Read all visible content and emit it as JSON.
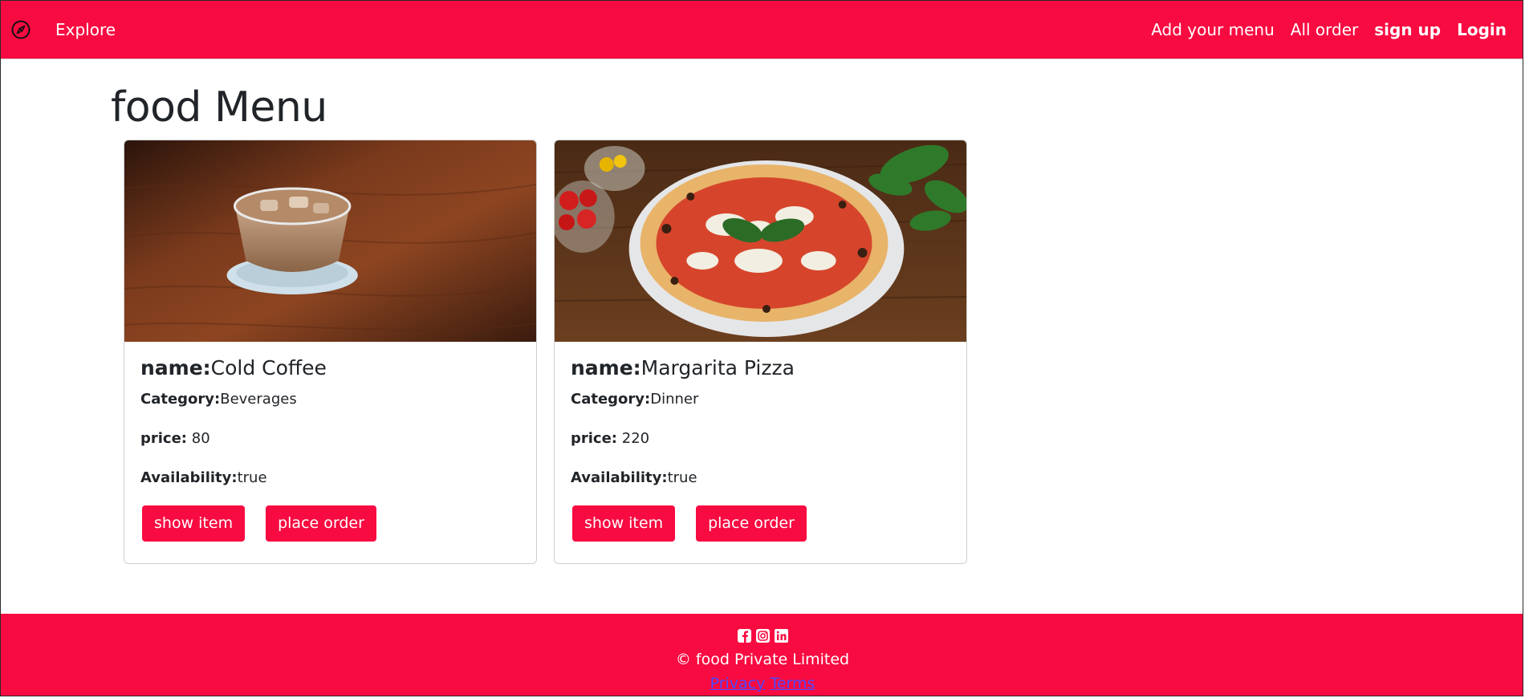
{
  "navbar": {
    "brand_icon": "compass-icon",
    "explore_label": "Explore",
    "links": {
      "add_menu": "Add your menu",
      "all_order": "All order",
      "sign_up": "sign up",
      "login": "Login"
    }
  },
  "page": {
    "title": "food Menu"
  },
  "cards": [
    {
      "image": "iced-coffee-photo",
      "name_label": "name:",
      "name": "Cold Coffee",
      "category_label": "Category:",
      "category": "Beverages",
      "price_label": "price:",
      "price": "80",
      "availability_label": "Availability:",
      "availability": "true",
      "show_label": "show item",
      "order_label": "place order"
    },
    {
      "image": "margherita-pizza-photo",
      "name_label": "name:",
      "name": "Margarita Pizza",
      "category_label": "Category:",
      "category": "Dinner",
      "price_label": "price:",
      "price": "220",
      "availability_label": "Availability:",
      "availability": "true",
      "show_label": "show item",
      "order_label": "place order"
    }
  ],
  "footer": {
    "social_icons": [
      "facebook-icon",
      "instagram-icon",
      "linkedin-icon"
    ],
    "copyright": "© food Private Limited",
    "privacy_label": "Privacy",
    "terms_label": "Terms"
  },
  "colors": {
    "brand": "#f80b41",
    "link": "#4a4aff"
  }
}
